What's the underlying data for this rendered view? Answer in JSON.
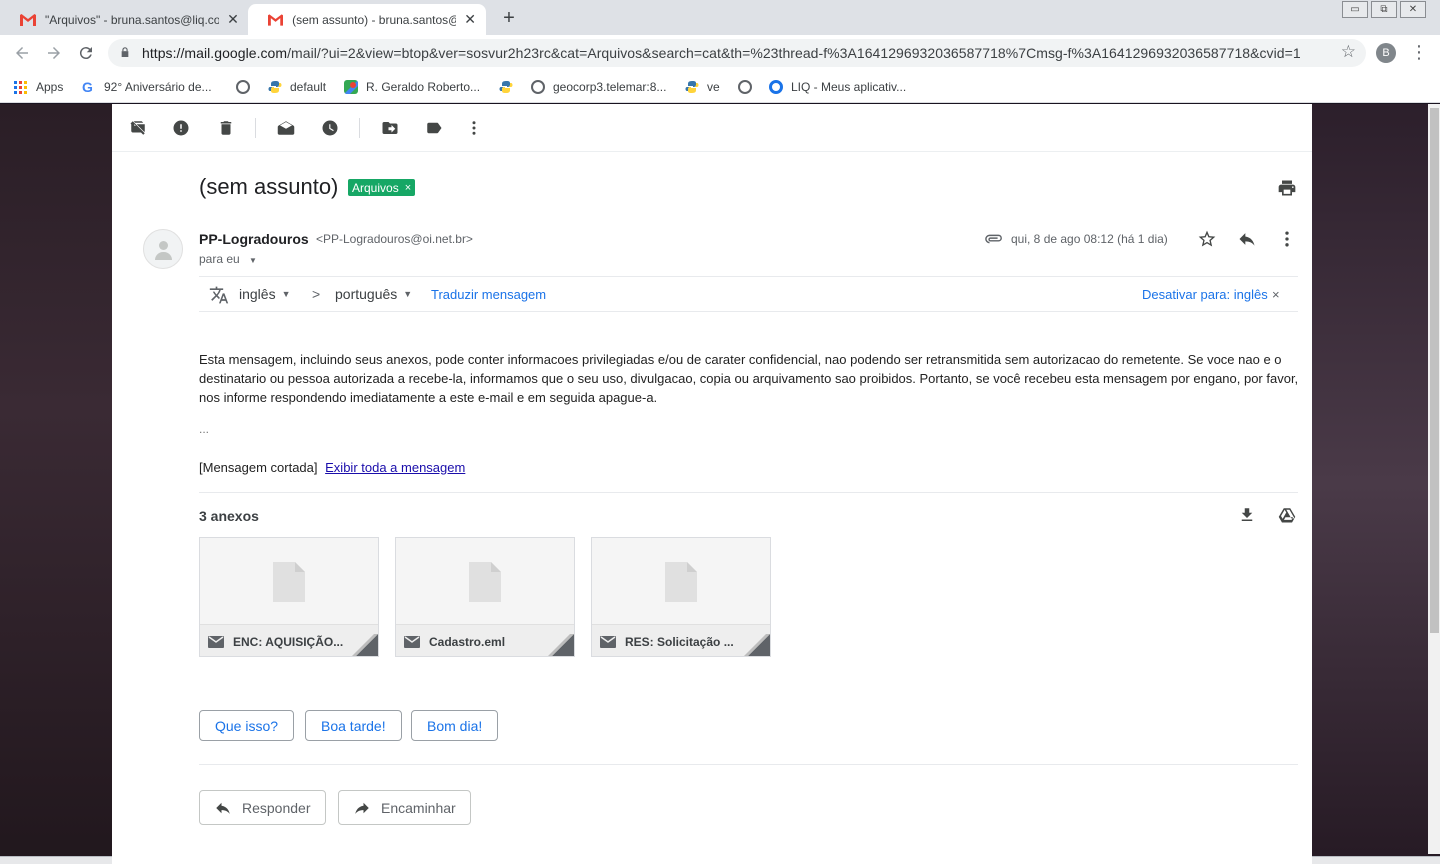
{
  "browser": {
    "tabs": [
      {
        "title": "\"Arquivos\" - bruna.santos@liq.co",
        "close": "✕",
        "active": false
      },
      {
        "title": "(sem assunto) - bruna.santos@liq",
        "close": "✕",
        "active": true
      }
    ],
    "new_tab": "+",
    "window_controls": [
      "▭",
      "⧉",
      "✕"
    ],
    "url_host": "https://mail.google.com",
    "url_rest": "/mail/?ui=2&view=btop&ver=sosvur2h23rc&cat=Arquivos&search=cat&th=%23thread-f%3A1641296932036587718%7Cmsg-f%3A1641296932036587718&cvid=1",
    "profile_initial": "B",
    "bookmarks": [
      {
        "label": "Apps",
        "icon": "apps-grid-icon"
      },
      {
        "label": "92° Aniversário de...",
        "icon": "google-g-icon"
      },
      {
        "label": "",
        "icon": "globe-icon"
      },
      {
        "label": "default",
        "icon": "python-icon"
      },
      {
        "label": "R. Geraldo Roberto...",
        "icon": "maps-icon"
      },
      {
        "label": "",
        "icon": "python-icon"
      },
      {
        "label": "geocorp3.telemar:8...",
        "icon": "globe-icon"
      },
      {
        "label": "ve",
        "icon": "python-icon"
      },
      {
        "label": "",
        "icon": "globe-icon"
      },
      {
        "label": "LIQ - Meus aplicativ...",
        "icon": "ring-icon"
      }
    ]
  },
  "mail": {
    "subject": "(sem assunto)",
    "label": "Arquivos",
    "label_remove": "×",
    "sender_name": "PP-Logradouros",
    "sender_email": "<PP-Logradouros@oi.net.br>",
    "to_line": "para eu",
    "date": "qui, 8 de ago 08:12 (há 1 dia)",
    "translate": {
      "from": "inglês",
      "arrow": ">",
      "to": "português",
      "translate_link": "Traduzir mensagem",
      "disable_link": "Desativar para: inglês",
      "close": "×"
    },
    "body": "Esta mensagem, incluindo seus anexos, pode conter informacoes privilegiadas e/ou de carater confidencial, nao podendo ser retransmitida sem autorizacao do remetente. Se voce nao e o destinatario ou pessoa autorizada a recebe-la, informamos que o seu uso, divulgacao, copia ou arquivamento sao proibidos. Portanto, se você recebeu esta mensagem por engano, por favor, nos informe respondendo imediatamente a este e-mail e em seguida apague-a.",
    "ellipsis": "...",
    "clipped_label": "[Mensagem cortada]",
    "clipped_link": "Exibir toda a mensagem",
    "attachments_title": "3 anexos",
    "attachments": [
      {
        "name": "ENC: AQUISIÇÃO..."
      },
      {
        "name": "Cadastro.eml"
      },
      {
        "name": "RES: Solicitação ..."
      }
    ],
    "smart_replies": [
      "Que isso?",
      "Boa tarde!",
      "Bom dia!"
    ],
    "reply_label": "Responder",
    "forward_label": "Encaminhar"
  }
}
